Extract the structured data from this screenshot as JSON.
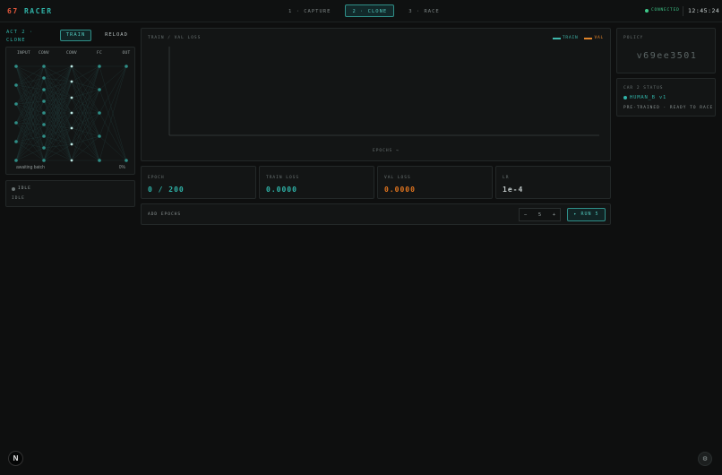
{
  "header": {
    "logo_number": "67",
    "logo_text": "RACER",
    "steps": [
      {
        "label": "1 · CAPTURE"
      },
      {
        "label": "2 · CLONE"
      },
      {
        "label": "3 · RACE"
      }
    ],
    "active_step": 1,
    "connection": "CONNECTED",
    "clock": "12:45:24"
  },
  "left": {
    "act_label": "ACT 2 · CLONE",
    "train_label": "TRAIN",
    "reload_label": "RELOAD",
    "network": {
      "layers": [
        "INPUT",
        "CONV",
        "CONV",
        "FC",
        "OUT"
      ],
      "status": "awaiting batch",
      "progress": "0%"
    },
    "idle": {
      "state": "IDLE",
      "message": "IDLE"
    }
  },
  "chart": {
    "title": "TRAIN / VAL LOSS",
    "legend_train": "TRAIN",
    "legend_val": "VAL",
    "xlabel": "EPOCHS →"
  },
  "chart_data": {
    "type": "line",
    "title": "TRAIN / VAL LOSS",
    "xlabel": "EPOCHS →",
    "ylabel": "",
    "series": [
      {
        "name": "TRAIN",
        "values": []
      },
      {
        "name": "VAL",
        "values": []
      }
    ],
    "legend": "top-right"
  },
  "metrics": [
    {
      "label": "EPOCH",
      "value": "0 / 200",
      "color": "teal"
    },
    {
      "label": "TRAIN LOSS",
      "value": "0.0000",
      "color": "teal"
    },
    {
      "label": "VAL LOSS",
      "value": "0.0000",
      "color": "orange"
    },
    {
      "label": "LR",
      "value": "1e-4",
      "color": "gray"
    }
  ],
  "add_epochs": {
    "label": "ADD EPOCHS",
    "minus": "−",
    "value": "5",
    "plus": "+",
    "run_label": "▸ RUN 5"
  },
  "right": {
    "policy_label": "POLICY",
    "policy_value": "v69ee3501",
    "status_label": "CAR 2 STATUS",
    "model": "HUMAN_B v1",
    "sub": "PRE-TRAINED · READY TO RACE"
  },
  "corner": {
    "left_icon": "N",
    "right_icon": "⚙"
  },
  "colors": {
    "accent": "#30b3a8",
    "orange": "#e4761f",
    "red": "#e0563b",
    "bg": "#0e0f0f"
  }
}
